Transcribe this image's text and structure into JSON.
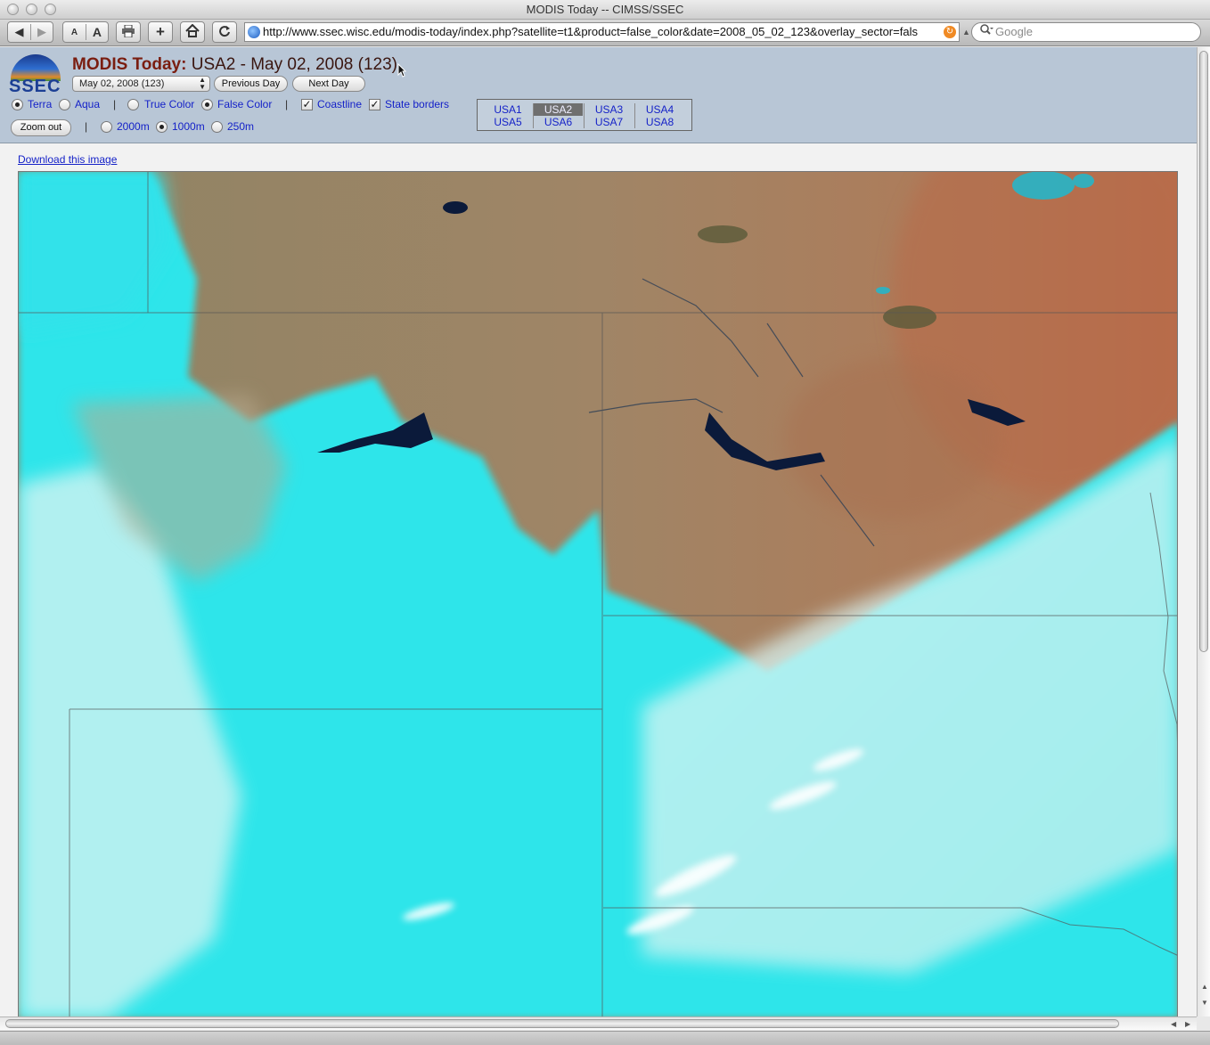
{
  "window": {
    "title": "MODIS Today -- CIMSS/SSEC"
  },
  "browser": {
    "url": "http://www.ssec.wisc.edu/modis-today/index.php?satellite=t1&product=false_color&date=2008_05_02_123&overlay_sector=fals",
    "search_placeholder": "Google",
    "font_small": "A",
    "font_large": "A"
  },
  "header": {
    "logo_text": "SSEC",
    "brand": "MODIS Today:",
    "subtitle": " USA2 - May 02, 2008 (123)",
    "date_select": "May 02, 2008 (123)",
    "prev_label": "Previous Day",
    "next_label": "Next Day",
    "satellites": [
      {
        "label": "Terra",
        "selected": true
      },
      {
        "label": "Aqua",
        "selected": false
      }
    ],
    "products": [
      {
        "label": "True Color",
        "selected": false
      },
      {
        "label": "False Color",
        "selected": true
      }
    ],
    "overlays": [
      {
        "label": "Coastline",
        "checked": true
      },
      {
        "label": "State borders",
        "checked": true
      }
    ],
    "zoom_out_label": "Zoom out",
    "resolutions": [
      {
        "label": "2000m",
        "selected": false
      },
      {
        "label": "1000m",
        "selected": true
      },
      {
        "label": "250m",
        "selected": false
      }
    ],
    "sectors_row1": [
      "USA1",
      "USA2",
      "USA3",
      "USA4"
    ],
    "sectors_row2": [
      "USA5",
      "USA6",
      "USA7",
      "USA8"
    ],
    "current_sector": "USA2"
  },
  "download_label": "Download this image",
  "colors": {
    "land": "#9a8466",
    "snow_cloud": "#2fe6ea",
    "cloud_white": "#f4f6f4",
    "water": "#0b1a3a",
    "link": "#1522c8",
    "brand": "#7a1d10"
  },
  "icons": {
    "back": "back-arrow-icon",
    "forward": "forward-arrow-icon",
    "print": "print-icon",
    "add_bookmark": "plus-icon",
    "home": "home-icon",
    "reload": "reload-icon",
    "search": "magnifier-icon",
    "rss": "rss-icon"
  }
}
